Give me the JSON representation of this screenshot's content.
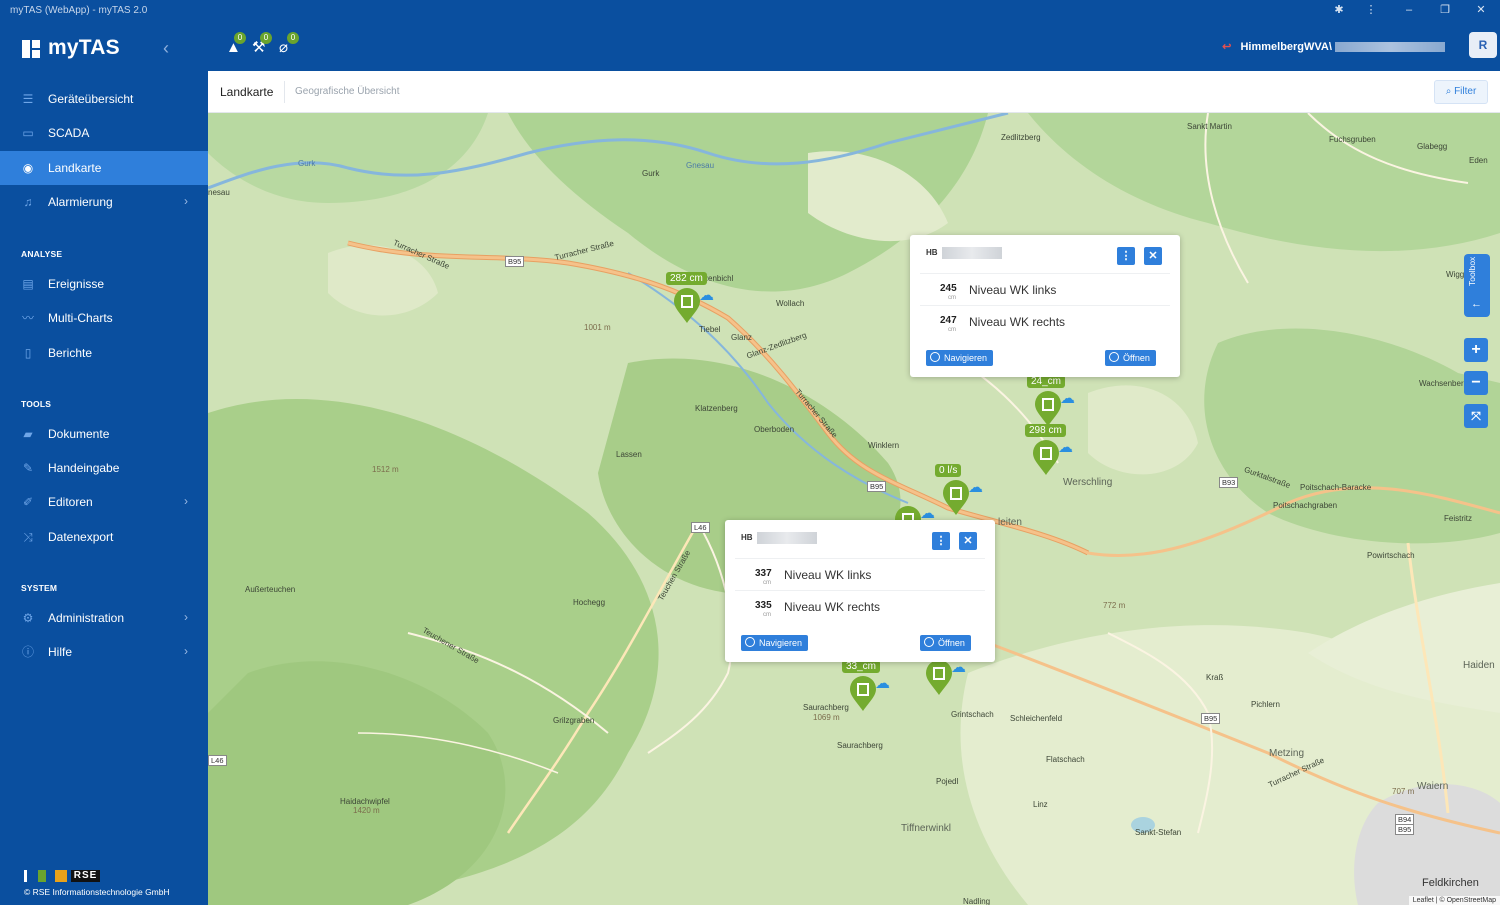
{
  "window": {
    "title": "myTAS (WebApp) - myTAS 2.0",
    "controls": [
      "extension-icon",
      "more-icon",
      "minimize-icon",
      "maximize-icon",
      "close-icon"
    ]
  },
  "header": {
    "app_name": "myTAS",
    "alerts": [
      {
        "icon": "warning-icon",
        "count": "0"
      },
      {
        "icon": "maintenance-icon",
        "count": "0"
      },
      {
        "icon": "signal-off-icon",
        "count": "0"
      }
    ],
    "user": {
      "station": "HimmelbergWVA\\",
      "avatar_initial": "R"
    }
  },
  "sidebar": {
    "items": [
      {
        "label": "Geräteübersicht",
        "icon": "list-icon"
      },
      {
        "label": "SCADA",
        "icon": "monitor-icon"
      },
      {
        "label": "Landkarte",
        "icon": "map-pin-icon",
        "active": true
      },
      {
        "label": "Alarmierung",
        "icon": "bell-icon",
        "chevron": true
      }
    ],
    "section_analyse": "ANALYSE",
    "analyse_items": [
      {
        "label": "Ereignisse",
        "icon": "events-icon"
      },
      {
        "label": "Multi-Charts",
        "icon": "chart-line-icon"
      },
      {
        "label": "Berichte",
        "icon": "report-icon"
      }
    ],
    "section_tools": "TOOLS",
    "tools_items": [
      {
        "label": "Dokumente",
        "icon": "folder-icon"
      },
      {
        "label": "Handeingabe",
        "icon": "pencil-icon"
      },
      {
        "label": "Editoren",
        "icon": "editor-icon",
        "chevron": true
      },
      {
        "label": "Datenexport",
        "icon": "export-icon"
      }
    ],
    "section_system": "SYSTEM",
    "system_items": [
      {
        "label": "Administration",
        "icon": "gears-icon",
        "chevron": true
      },
      {
        "label": "Hilfe",
        "icon": "info-icon",
        "chevron": true
      }
    ],
    "company_logo": "RSE",
    "copyright": "© RSE Informationstechnologie GmbH"
  },
  "subheader": {
    "breadcrumb": "Landkarte",
    "description": "Geografische Übersicht",
    "filter_label": "Filter"
  },
  "map": {
    "labels": [
      "Zedlitzberg",
      "Sankt Martin",
      "Fuchsgruben",
      "Glabegg",
      "Eden",
      "Gurk",
      "Gurk",
      "Gnesau",
      "nesau",
      "Turracher Straße",
      "B95",
      "Turracher Straße",
      "zenbichl",
      "1001 m",
      "Wollach",
      "Tiebel",
      "Glanz",
      "Glanz-Zedlitzberg",
      "Klatzenberg",
      "Oberboden",
      "Turracher Straße",
      "Winklern",
      "Lassen",
      "1512 m",
      "B95",
      "Werschling",
      "B93",
      "Gurktalstraße",
      "Poitschach-Baracke",
      "Poitschachgraben",
      "Feistritz",
      "L46",
      "Außerteuchen",
      "Hochegg",
      "Teuchen Straße",
      "Teuchener Straße",
      "772 m",
      "Powirtschach",
      "Grilzgraben",
      "Kraß",
      "Pichlern",
      "B95",
      "Haiden",
      "Saurachberg",
      "1069 m",
      "Saurachberg",
      "Grintschach",
      "Schleichenfeld",
      "Flatschach",
      "Metzing",
      "L46",
      "Haidachwipfel",
      "1420 m",
      "Pojedl",
      "Linz",
      "707 m",
      "Waiern",
      "Tiffnerwinkl",
      "Sankt-Stefan",
      "B94",
      "B95",
      "Feldkirchen",
      "Wachsenberg",
      "Wigg",
      "Turracher Straße",
      "leiten",
      "Nadling"
    ],
    "marker_labels": [
      "282 cm",
      "24_cm",
      "298 cm",
      "0 l/s",
      "33_cm"
    ],
    "popups": [
      {
        "prefix": "HB",
        "rows": [
          {
            "value": "245",
            "unit": "cm",
            "label": "Niveau WK links"
          },
          {
            "value": "247",
            "unit": "cm",
            "label": "Niveau WK rechts"
          }
        ],
        "navigate": "Navigieren",
        "open": "Öffnen"
      },
      {
        "prefix": "HB",
        "rows": [
          {
            "value": "337",
            "unit": "cm",
            "label": "Niveau WK links"
          },
          {
            "value": "335",
            "unit": "cm",
            "label": "Niveau WK rechts"
          }
        ],
        "navigate": "Navigieren",
        "open": "Öffnen"
      }
    ],
    "toolbox_label": "Toolbox",
    "zoom_in": "+",
    "zoom_out": "−",
    "attribution": "Leaflet | © OpenStreetMap"
  },
  "colors": {
    "primary": "#0a4f9f",
    "accent": "#2f7fdb",
    "marker_green": "#74ab2f",
    "map_green": "#cfe2b6"
  }
}
